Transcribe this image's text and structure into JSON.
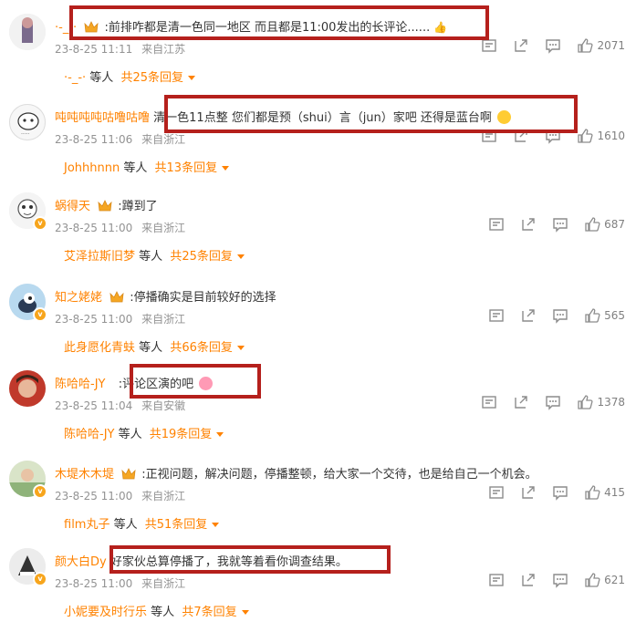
{
  "comments": [
    {
      "username": "·-_-·",
      "text": ":前排咋都是清一色同一地区 而且都是11:00发出的长评论......",
      "date": "23-8-25 11:11",
      "location": "来自江苏",
      "likes": "2071",
      "reply_user": "·-_-·",
      "reply_mid": "等人",
      "reply_count": "共25条回复"
    },
    {
      "username": "吨吨吨吨咕噜咕噜",
      "text": "清一色11点整 您们都是预（shui）言（jun）家吧 还得是蓝台啊",
      "date": "23-8-25 11:06",
      "location": "来自浙江",
      "likes": "1610",
      "reply_user": "Johhhnnn",
      "reply_mid": "等人",
      "reply_count": "共13条回复"
    },
    {
      "username": "蜗得天",
      "text": ":蹲到了",
      "date": "23-8-25 11:00",
      "location": "来自浙江",
      "likes": "687",
      "reply_user": "艾泽拉斯旧梦",
      "reply_mid": "等人",
      "reply_count": "共25条回复"
    },
    {
      "username": "知之姥姥",
      "text": ":停播确实是目前较好的选择",
      "date": "23-8-25 11:00",
      "location": "来自浙江",
      "likes": "565",
      "reply_user": "此身愿化青蚨",
      "reply_mid": "等人",
      "reply_count": "共66条回复"
    },
    {
      "username": "陈哈哈-JY",
      "text": ":评论区演的吧",
      "date": "23-8-25 11:04",
      "location": "来自安徽",
      "likes": "1378",
      "reply_user": "陈哈哈-JY",
      "reply_mid": "等人",
      "reply_count": "共19条回复"
    },
    {
      "username": "木堤木木堤",
      "text": ":正视问题，解决问题，停播整顿，给大家一个交待，也是给自己一个机会。",
      "date": "23-8-25 11:00",
      "location": "来自浙江",
      "likes": "415",
      "reply_user": "film丸子",
      "reply_mid": "等人",
      "reply_count": "共51条回复"
    },
    {
      "username": "颜大白Dy",
      "text": "好家伙总算停播了，我就等着看你调查结果。",
      "date": "23-8-25 11:00",
      "location": "来自浙江",
      "likes": "621",
      "reply_user": "小妮要及时行乐",
      "reply_mid": "等人",
      "reply_count": "共7条回复"
    }
  ],
  "colors": {
    "username": "#ff8200",
    "meta": "#939393",
    "highlight_box": "#b5201c"
  }
}
